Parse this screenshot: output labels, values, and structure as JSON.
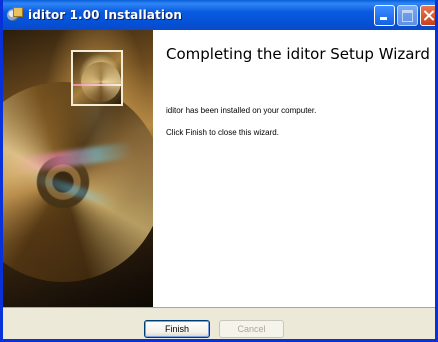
{
  "window": {
    "title": "iditor 1.00 Installation"
  },
  "wizard": {
    "heading": "Completing the iditor Setup Wizard",
    "installed_message": "iditor has been installed on your computer.",
    "close_message": "Click Finish to close this wizard."
  },
  "buttons": {
    "finish_label": "Finish",
    "cancel_label": "Cancel",
    "cancel_enabled": false
  },
  "icons": {
    "window_icon": "installer-icon",
    "minimize": "minimize-icon",
    "maximize": "maximize-icon",
    "close": "close-icon"
  },
  "colors": {
    "titlebar": "#0a5ae0",
    "frame": "#0831d9",
    "close_button": "#c9411a",
    "dialog_background": "#ece9d8"
  }
}
